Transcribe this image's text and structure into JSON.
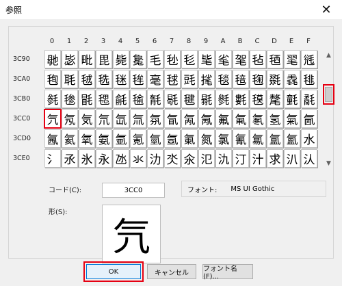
{
  "window": {
    "title": "参照",
    "close_glyph": "✕"
  },
  "column_headers": [
    "0",
    "1",
    "2",
    "3",
    "4",
    "5",
    "6",
    "7",
    "8",
    "9",
    "A",
    "B",
    "C",
    "D",
    "E",
    "F"
  ],
  "rows": [
    {
      "label": "3C90",
      "chars": [
        "毑",
        "毖",
        "毗",
        "毘",
        "毙",
        "毚",
        "毛",
        "毜",
        "毝",
        "毞",
        "毟",
        "毠",
        "毡",
        "毢",
        "毣",
        "毤"
      ]
    },
    {
      "label": "3CA0",
      "chars": [
        "毥",
        "毦",
        "毧",
        "毨",
        "毩",
        "毪",
        "毫",
        "毬",
        "毭",
        "毮",
        "毯",
        "毰",
        "毱",
        "毲",
        "毳",
        "毴"
      ]
    },
    {
      "label": "3CB0",
      "chars": [
        "毵",
        "毶",
        "毷",
        "毸",
        "毹",
        "毺",
        "毻",
        "毼",
        "毽",
        "毾",
        "毿",
        "氀",
        "氁",
        "氂",
        "氃",
        "氄"
      ]
    },
    {
      "label": "3CC0",
      "chars": [
        "氕",
        "氖",
        "気",
        "氘",
        "氙",
        "氚",
        "氛",
        "氜",
        "氝",
        "氞",
        "氟",
        "氠",
        "氡",
        "氢",
        "氣",
        "氤"
      ]
    },
    {
      "label": "3CD0",
      "chars": [
        "氥",
        "氦",
        "氧",
        "氨",
        "氩",
        "氪",
        "氫",
        "氬",
        "氭",
        "氮",
        "氯",
        "氰",
        "氱",
        "氲",
        "氳",
        "水"
      ]
    },
    {
      "label": "3CE0",
      "chars": [
        "氵",
        "氶",
        "氷",
        "永",
        "氹",
        "氺",
        "氻",
        "氼",
        "氽",
        "氾",
        "氿",
        "汀",
        "汁",
        "求",
        "汃",
        "汄"
      ]
    }
  ],
  "selected": {
    "row": 3,
    "col": 0
  },
  "code": {
    "label": "コード(C):",
    "value": "3CC0"
  },
  "font": {
    "label": "フォント:",
    "name": "MS UI Gothic"
  },
  "shape": {
    "label": "形(S):",
    "char": "氕"
  },
  "buttons": {
    "ok": "OK",
    "cancel": "キャンセル",
    "font_name": "フォント名(F)..."
  },
  "scrollbar": {
    "up_icon": "▲",
    "down_icon": "▼"
  },
  "colors": {
    "highlight_red": "#e60012",
    "dialog_bg": "#f0f0f0"
  }
}
